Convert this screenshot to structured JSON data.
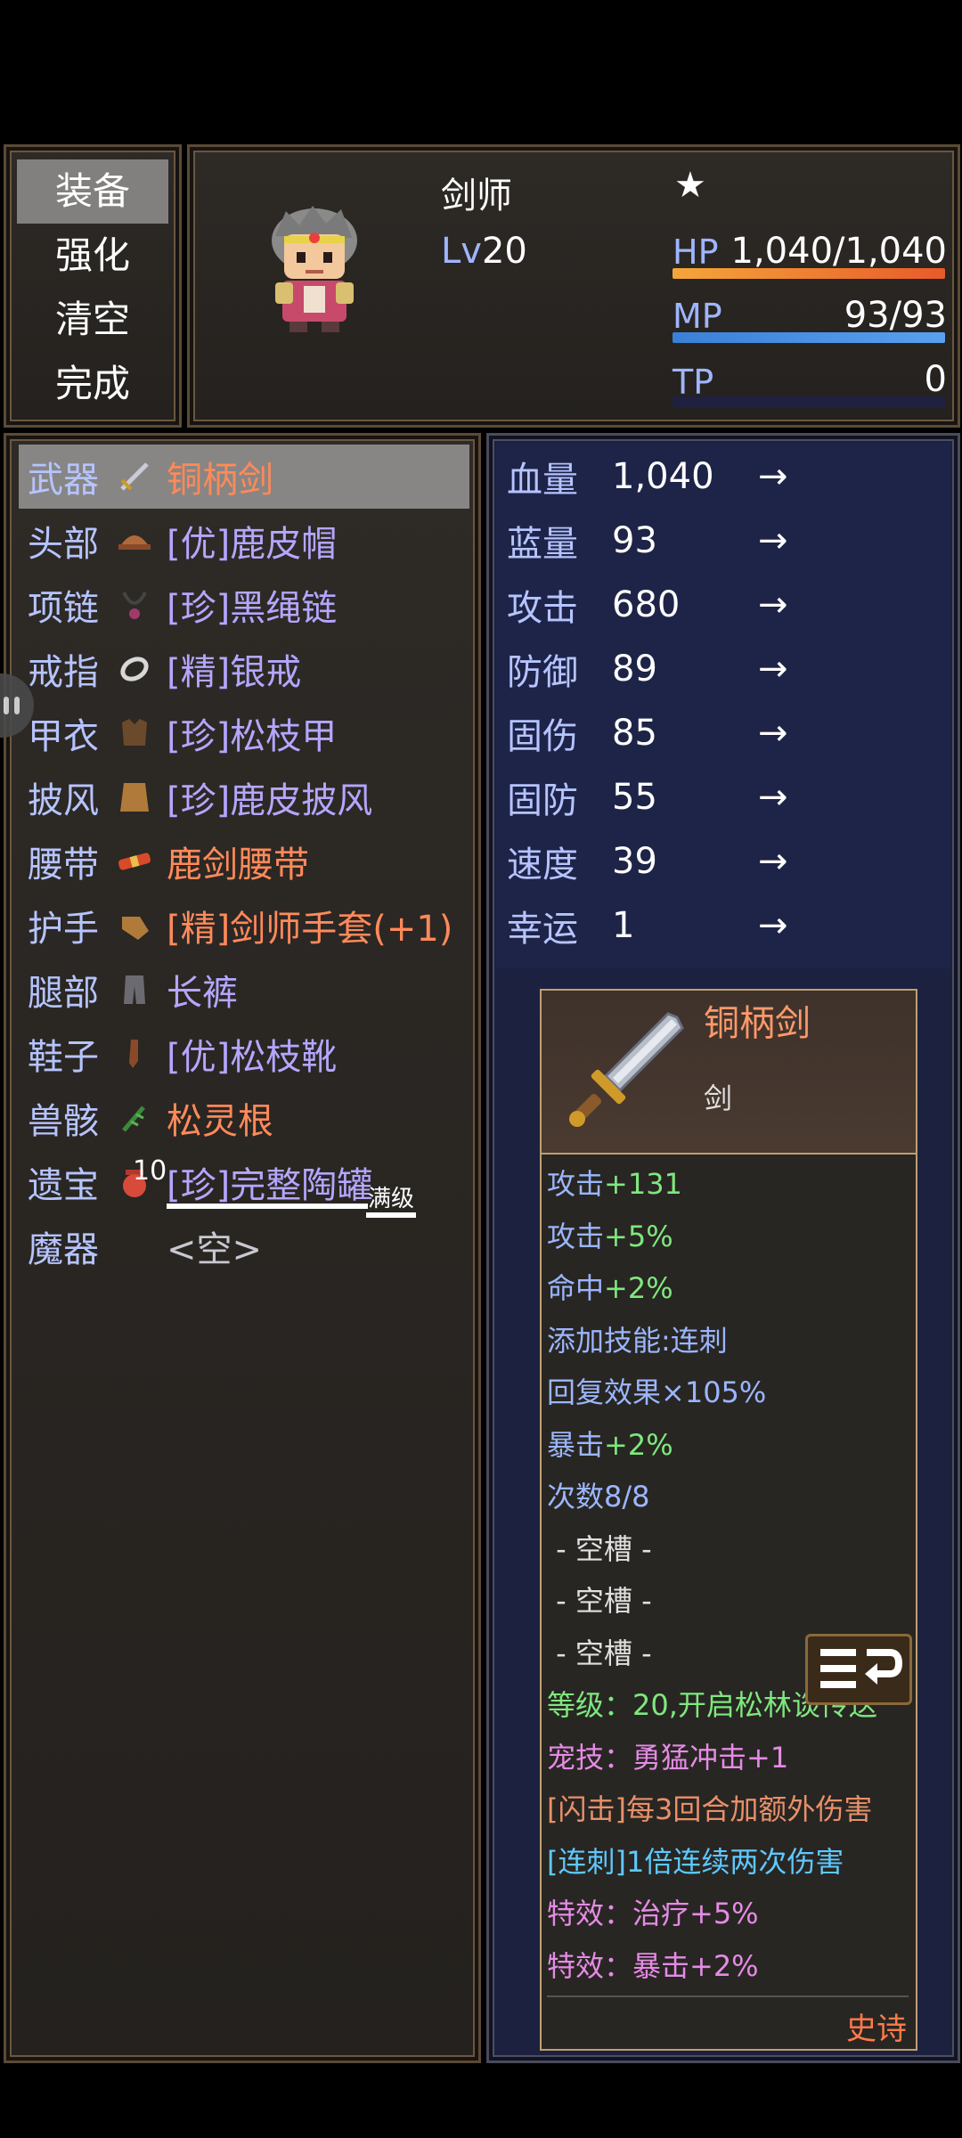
{
  "menu": {
    "items": [
      "装备",
      "强化",
      "清空",
      "完成"
    ],
    "selected_index": 0
  },
  "status": {
    "class_name": "剑师",
    "star": "★",
    "level_prefix": "Lv",
    "level": "20",
    "hp_label": "HP",
    "hp_value": "1,040/1,040",
    "hp_fraction": 1.0,
    "mp_label": "MP",
    "mp_value": "93/93",
    "mp_fraction": 1.0,
    "tp_label": "TP",
    "tp_value": "0",
    "tp_fraction": 0.0
  },
  "equipment": [
    {
      "slot": "武器",
      "icon": "sword-icon",
      "item": "铜柄剑",
      "color": "orange"
    },
    {
      "slot": "头部",
      "icon": "hat-icon",
      "item": "[优]鹿皮帽",
      "color": "purple"
    },
    {
      "slot": "项链",
      "icon": "necklace-icon",
      "item": "[珍]黑绳链",
      "color": "purple"
    },
    {
      "slot": "戒指",
      "icon": "ring-icon",
      "item": "[精]银戒",
      "color": "purple"
    },
    {
      "slot": "甲衣",
      "icon": "armor-icon",
      "item": "[珍]松枝甲",
      "color": "purple"
    },
    {
      "slot": "披风",
      "icon": "cape-icon",
      "item": "[珍]鹿皮披风",
      "color": "purple"
    },
    {
      "slot": "腰带",
      "icon": "belt-icon",
      "item": "鹿剑腰带",
      "color": "orange"
    },
    {
      "slot": "护手",
      "icon": "glove-icon",
      "item": "[精]剑师手套(+1)",
      "color": "orange"
    },
    {
      "slot": "腿部",
      "icon": "pants-icon",
      "item": "长裤",
      "color": "purple"
    },
    {
      "slot": "鞋子",
      "icon": "boot-icon",
      "item": "[优]松枝靴",
      "color": "purple"
    },
    {
      "slot": "兽骸",
      "icon": "root-icon",
      "item": "松灵根",
      "color": "orange"
    },
    {
      "slot": "遗宝",
      "icon": "jar-icon",
      "item": "[珍]完整陶罐",
      "color": "purple",
      "icon_badge": "10",
      "tag": "满级"
    },
    {
      "slot": "魔器",
      "icon": "",
      "item": "<空>",
      "color": "grey"
    }
  ],
  "stats": [
    {
      "name": "血量",
      "value": "1,040",
      "arrow": "→"
    },
    {
      "name": "蓝量",
      "value": "93",
      "arrow": "→"
    },
    {
      "name": "攻击",
      "value": "680",
      "arrow": "→"
    },
    {
      "name": "防御",
      "value": "89",
      "arrow": "→"
    },
    {
      "name": "固伤",
      "value": "85",
      "arrow": "→"
    },
    {
      "name": "固防",
      "value": "55",
      "arrow": "→"
    },
    {
      "name": "速度",
      "value": "39",
      "arrow": "→"
    },
    {
      "name": "幸运",
      "value": "1",
      "arrow": "→"
    }
  ],
  "detail": {
    "name": "铜柄剑",
    "type": "剑",
    "lines": [
      {
        "a": "攻击",
        "b": "+131",
        "ca": "b",
        "cb": "g"
      },
      {
        "a": "攻击",
        "b": "+5%",
        "ca": "b",
        "cb": "g"
      },
      {
        "a": "命中",
        "b": "+2%",
        "ca": "b",
        "cb": "g"
      },
      {
        "a": "添加技能:连刺",
        "b": "",
        "ca": "b",
        "cb": "g"
      },
      {
        "a": "回复效果",
        "b": "×105%",
        "ca": "b",
        "cb": "b"
      },
      {
        "a": "暴击",
        "b": "+2%",
        "ca": "b",
        "cb": "g"
      },
      {
        "a": "次数8/8",
        "b": "",
        "ca": "b",
        "cb": "b"
      },
      {
        "a": " - 空槽 -",
        "b": "",
        "ca": "w",
        "cb": "w"
      },
      {
        "a": " - 空槽 -",
        "b": "",
        "ca": "w",
        "cb": "w"
      },
      {
        "a": " - 空槽 -",
        "b": "",
        "ca": "w",
        "cb": "w"
      },
      {
        "a": "等级：20,开启松林谈传送",
        "b": "",
        "ca": "g",
        "cb": "g"
      },
      {
        "a": "宠技：勇猛冲击+1",
        "b": "",
        "ca": "pk",
        "cb": "pk"
      },
      {
        "a": "[闪击]每3回合加额外伤害",
        "b": "",
        "ca": "or",
        "cb": "or"
      },
      {
        "a": "[连刺]1倍连续两次伤害",
        "b": "",
        "ca": "cy",
        "cb": "cy"
      },
      {
        "a": "特效：治疗+5%",
        "b": "",
        "ca": "pk",
        "cb": "pk"
      },
      {
        "a": "特效：暴击+2%",
        "b": "",
        "ca": "pk",
        "cb": "pk"
      }
    ],
    "rarity": "史诗"
  },
  "colors": {
    "slot_label": "#b6c4ff",
    "item_orange": "#ff8a5a",
    "item_purple": "#b5a6ff",
    "hp_bar_start": "#f5a63a",
    "hp_bar_end": "#e85a2a",
    "mp_bar": "#3a80d8"
  }
}
